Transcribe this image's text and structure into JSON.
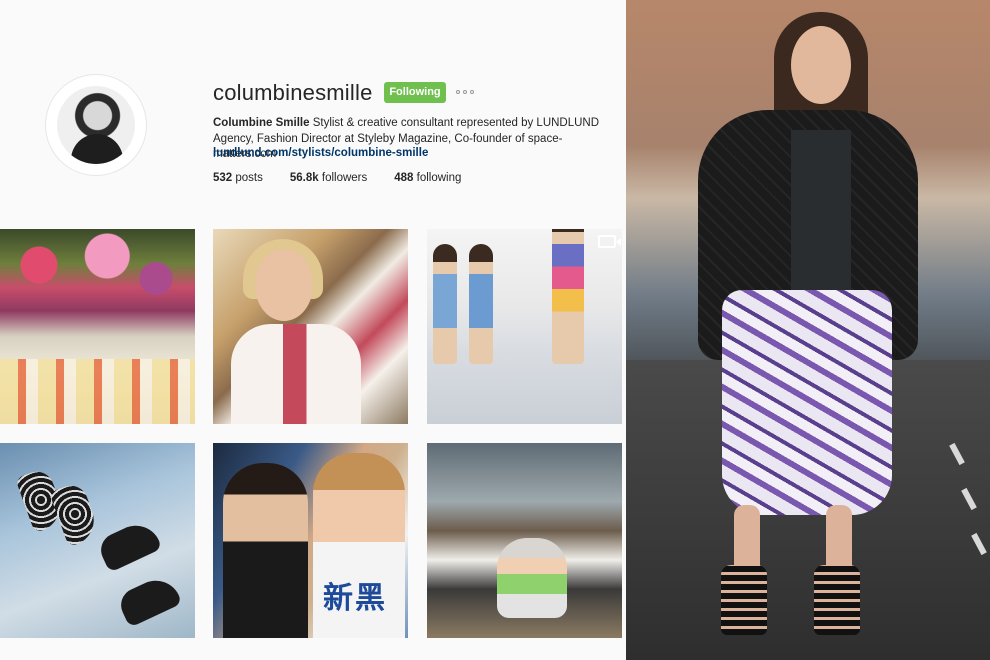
{
  "profile": {
    "username": "columbinesmille",
    "follow_label": "Following",
    "bio_name": "Columbine Smille",
    "bio_text": "Stylist & creative consultant represented by LUNDLUND Agency, Fashion Director at Styleby Magazine, Co-founder of space-matters.com",
    "link": "lundlund.com/stylists/columbine-smille",
    "stats": {
      "posts_count": "532",
      "posts_label": "posts",
      "followers_count": "56.8k",
      "followers_label": "followers",
      "following_count": "488",
      "following_label": "following"
    },
    "colors": {
      "follow_button": "#70c050",
      "link": "#003569",
      "text": "#262626"
    }
  },
  "grid": {
    "tiles": [
      {
        "subject": "flowers-and-pastries"
      },
      {
        "subject": "woman-with-dessert"
      },
      {
        "subject": "runway-models",
        "icon": "video-camera-icon"
      },
      {
        "subject": "shoes-on-floor"
      },
      {
        "subject": "two-women-selfie",
        "shirt_text": "新黑"
      },
      {
        "subject": "woman-holding-baby"
      }
    ]
  },
  "photo": {
    "subject": "street-style-woman-black-jacket-purple-print-shorts"
  }
}
